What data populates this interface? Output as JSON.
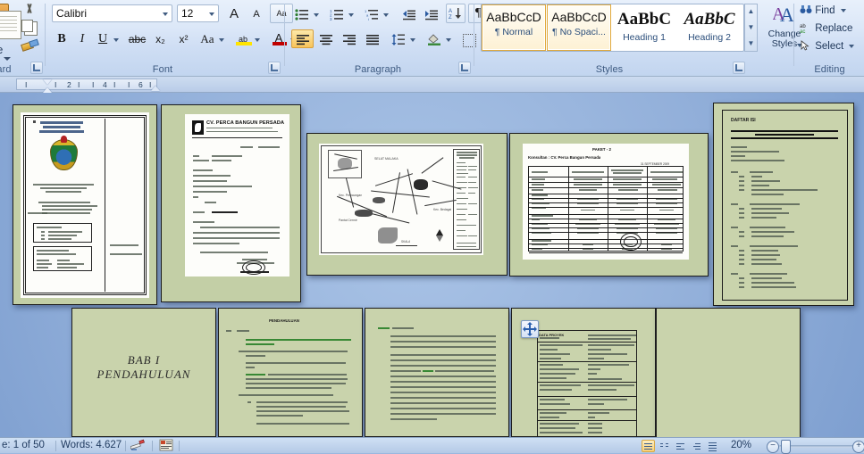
{
  "ribbon": {
    "groups": [
      {
        "name": "Clipboard",
        "label": "board"
      },
      {
        "name": "Font",
        "label": "Font"
      },
      {
        "name": "Paragraph",
        "label": "Paragraph"
      },
      {
        "name": "Styles",
        "label": "Styles"
      },
      {
        "name": "Editing",
        "label": "Editing"
      }
    ],
    "clipboard": {
      "paste_label": "ste",
      "group_label": "board"
    },
    "font": {
      "font_name": "Calibri",
      "font_size": "12",
      "bold": "B",
      "italic": "I",
      "underline": "U",
      "strikethrough": "abc",
      "subscript": "x₂",
      "superscript": "x²",
      "change_case": "Aa",
      "highlight": "ab",
      "font_color": "A",
      "grow_font": "A",
      "shrink_font": "A",
      "clear_formatting": "Aa",
      "group_label": "Font"
    },
    "paragraph": {
      "group_label": "Paragraph"
    },
    "styles": {
      "group_label": "Styles",
      "items": [
        {
          "sample": "AaBbCcD",
          "name": "¶ Normal",
          "selected": true
        },
        {
          "sample": "AaBbCcD",
          "name": "¶ No Spaci...",
          "selected": true
        },
        {
          "sample": "AaBbC",
          "name": "Heading 1",
          "selected": false
        },
        {
          "sample": "AaBbC",
          "name": "Heading 2",
          "selected": false
        }
      ],
      "change_styles_line1": "Change",
      "change_styles_line2": "Styles"
    },
    "editing": {
      "group_label": "Editing",
      "find": "Find",
      "replace": "Replace",
      "select": "Select"
    }
  },
  "ruler": {
    "ticks": [
      "I",
      "I",
      "2",
      "I",
      "I",
      "4",
      "I",
      "I",
      "6",
      "I"
    ]
  },
  "workspace": {
    "thumbnails": [
      {
        "id": "cover-page",
        "kind": "cover",
        "title_lines": [
          "PEMERINTAH PROPINSI",
          "SUMATERA UTARA",
          "DINAS BINA MARGA"
        ],
        "subtitle_lines": [
          "PEKERJAAN PENGAWASAN TEKNIS JALAN DAN",
          "PEMELIHARAAN RUTIN JALAN",
          "DAERAH KABUPATEN DAIRI"
        ],
        "list_lines": [
          "JENIS PEKERJAAN : PENGAWASAN TEKNIS",
          "1.  JALAN PERBAUNGAN - P. CERMIN",
          "2.  JALAN TJ. MORAWA - SEI RAMPAH",
          "3.  JALAN PERBAUNGAN - PANTAI CERMIN"
        ],
        "box1_lines": [
          "TAHUN ANGGARAN 2009",
          "1.    PENGAWASAN TEKNIS JALAN",
          "2.    PEMELIHARAAN RUTIN",
          "3.    PEMBANGUNAN"
        ],
        "box2_lines": [
          "KONSULTAN PENGAWAS :",
          "CV. PERCA BANGUN PERSADA",
          "Jl. Sei Mencirim No. 88",
          "Medan - Sumatera Utara",
          "Telp. : 061-8456789"
        ],
        "side_lines": [
          "LAPORAN BULANAN",
          "PERIODE : DESEMBER 2009"
        ]
      },
      {
        "id": "letter-page",
        "kind": "letter",
        "company": "CV. PERCA BANGUN PERSADA",
        "company_sub1": "CONSULTING ENGINEERS  •  PLANNING  •  SUPERVISION  •  MANAGEMENT",
        "company_sub2": "Jl. Sei Mencirim No. 88 Medan  Telp. (061) 845-6789  Fax (061) 845-6790",
        "date_place": "Medan,",
        "date_value": "September 2009",
        "ref_label": "No.",
        "ref_value": ": 45/CV-PBP/IX/2009",
        "att_label": "Lampiran",
        "att_value": ": 1 (satu) berkas",
        "to_lines": [
          "Kepada Yth :",
          "Bapak Pengguna Anggaran",
          "Bidang Pembinaan Teknis",
          "Dinas Bina Marga Propinsi Sumatera Utara",
          "Jalan Sakti Lubis No. 7B",
          "di -",
          "        Medan"
        ],
        "subject_label": "Perihal",
        "subject_value": ":  Laporan Bulanan",
        "salutation": "Dengan hormat,",
        "body_lines": [
          "Berdasarkan Surat Perjanjian Kerja / Kontrak Konsultan Paket 2 (dua), Pekerjaan",
          "Pengawasan Teknis dan Nomor : 602 / 086 / BT / KTR / 179 / 2009 tertanggal",
          "4  Agustus  2009, bersama ini kami sampaikan  Laporan Bulanan  untuk bulan September",
          "2009 sebagaimana terlampir.",
          "Demikian kami sampaikan, atas perhatian Bapak kami ucapkan terima kasih."
        ],
        "sign_lines": [
          "Konsultan Pengawas",
          "CV. PERCA BANGUN PERSADA"
        ],
        "sign_name": "MUHAMMAD SUWANDI",
        "sign_title": "Direktur Utama"
      },
      {
        "id": "map-page",
        "kind": "map",
        "legend_title_lines": [
          "PETA ADMINISTRASI KABUPATEN",
          "KABUPATEN SERDANG BEDAGAI",
          "PETA PENGAWASAN"
        ],
        "map_label1": "SELAT MALAKA",
        "map_label2": "Kec. Perbaungan",
        "map_label3": "Kec. Pantai Cermin",
        "scale_label": "SKALA"
      },
      {
        "id": "table-page",
        "kind": "table",
        "title": "PAKET - 2",
        "subtitle": "Konsultan : CV. Perca Bangun Persada",
        "date_note": "31 SEPTEMBER 2009",
        "columns": [
          "Nama Paket",
          "Jalan PERBAUNGAN - P. CERMIN",
          "JALAN SIMPANG KANAN - SEI RAMPAH - PERBAUNGAN",
          "Jalan PERBAUNGAN - BEDAGAI"
        ],
        "rows": [
          [
            "KONTRAKTOR",
            "PT. SARANA BUMI SEJATI",
            "PT. KARYA BUMI PERKASA",
            "PT. ARTA NIRMALA"
          ],
          [
            "No. Kontrak",
            "600 / 345 / APBD / 2009",
            "600 / 346 / APBD / 2009",
            "600 / 348 / APBD / 2009"
          ],
          [
            "Tgl. Kontrak",
            "14 JULI 2009",
            "3 AGUSTUS 2009",
            "3 AGUSTUS 2009"
          ],
          [
            "DANA PROYEK",
            "",
            "",
            ""
          ],
          [
            "Nilai Kontrak",
            "Rp 1.983.510.000",
            "Rp 1.983.510.000",
            "Rp 1.983.510.000"
          ],
          [
            "Nilai Kontrak Sekarang",
            "Rp 1.648.900.000",
            "Rp 1.748.214.000",
            "Rp 1.548.830.000"
          ],
          [
            "Panjang Efektif",
            "1,200 KM",
            "2,900 KM",
            "1,100 KM"
          ],
          [
            "MASA PELAKSANAAN",
            "",
            "",
            ""
          ],
          [
            "Mulai",
            "14 JULI 2009",
            "7 AGUSTUS 2009",
            "7 AGUSTUS 2009"
          ],
          [
            "Perkiraan Selesai",
            "28 NOPEMBER 2009",
            "28 NOPEMBER 2009",
            "28 NOPEMBER 2009"
          ],
          [
            "Waktu Pelaksanaan",
            "90 Hari Kalender",
            "120 Hari Kalender",
            "120 Hari Kalender"
          ],
          [
            "Masa Pemeliharaan",
            "180 Hari Kalender",
            "180 Hari Kalender",
            "180 Hari Kalender"
          ],
          [
            "BOBOT / TERPASANG",
            "",
            "",
            ""
          ],
          [
            "Rencana s/d Sekarang",
            "55,70 %",
            "32,40 %",
            "35,70 %"
          ],
          [
            "Realisasi",
            "56,13 %",
            "33,15 %",
            "36,20 %"
          ],
          [
            "PROGRESS",
            "",
            "",
            ""
          ],
          [
            "Rencana",
            "45,70",
            "31,80",
            "35,90"
          ],
          [
            "Realisasi",
            "46,13",
            "32,40",
            "36,20"
          ],
          [
            "Deviasi",
            "+0,43",
            "+0,60",
            "+0,30"
          ]
        ]
      },
      {
        "id": "toc-page",
        "kind": "toc",
        "title": "DAFTAR ISI",
        "banner": "LAPORAN BULANAN SEPTEMBER 2009",
        "header_lines": [
          "KEGIATAN :",
          "PENGAWASAN TEKNIS JALAN DAN JEMBATAN",
          "PAKET : 2",
          "PEKERJAAN : PENGAWASAN TEKNIS JALAN"
        ],
        "entries": [
          {
            "num": "BAB   I",
            "title": "PENDAHULUAN"
          },
          {
            "num": "1.1",
            "title": "UMUM"
          },
          {
            "num": "1.2",
            "title": "LATAR BELAKANG PROYEK"
          },
          {
            "num": "1.3",
            "title": "DATA PROYEK"
          },
          {
            "num": "1.4",
            "title": "MAKSUD DAN TUJUAN PEKERJAAN PENGAWASAN"
          },
          {
            "num": "BAB   II",
            "title": "ORGANISASI PELAKSANA PEKERJAAN"
          },
          {
            "num": "2.1",
            "title": "PEMBERI PEKERJAAN"
          },
          {
            "num": "2.2",
            "title": "PELAKSANA KEGIATAN PROYEK"
          },
          {
            "num": "2.3",
            "title": "PIHAK KONSULTAN"
          },
          {
            "num": "BAB   III",
            "title": "PELAKSANAAN PEKERJAAN"
          },
          {
            "num": "3.1",
            "title": "PELAKSANAAN PENGAWASAN"
          },
          {
            "num": "3.2",
            "title": "PENGENDALIAN MUTU"
          },
          {
            "num": "BAB   IV",
            "title": "KEMAJUAN PELAKSANAAN PROYEK"
          },
          {
            "num": "4.1",
            "title": "RENCANA PEKERJAAN"
          },
          {
            "num": "4.2",
            "title": "RENCANA PELAKSANAAN"
          },
          {
            "num": "4.3",
            "title": "RENCANA KEMAJUAN"
          },
          {
            "num": "4.4",
            "title": "RENCANA PROGRES KERJA"
          },
          {
            "num": "BAB   V",
            "title": "KESIMPULAN DAN SARAN"
          },
          {
            "num": "5.1",
            "title": "UMUM DAN KESIMPULAN"
          },
          {
            "num": "5.2",
            "title": "LAPORAN PENGAWASAN LAPANGAN"
          },
          {
            "num": "5.3",
            "title": "EVALUASI PEKERJAAN LAPANGAN"
          },
          {
            "num": "LAMPIRAN",
            "title": "FOTO DOKUMENTASI"
          }
        ]
      },
      {
        "id": "bab1-page",
        "kind": "chapter",
        "line1": "BAB I",
        "line2": "PENDAHULUAN"
      },
      {
        "id": "intro-page",
        "kind": "body-green",
        "heading": "PENDAHULUAN",
        "section_num": "1.1",
        "section_title": "UMUM",
        "paragraphs": [
          "Pembangunan prasarana jalan merupakan salah satu sarana penunjang",
          "pertumbuhan ekonomi daerah, sehingga perlu dilakukan peningkatan dan",
          "pemeliharaan jalan secara terus menerus agar dapat berfungsi dengan baik.",
          "Dalam rangka peningkatan pelayanan transportasi, Pemerintah Propinsi",
          "Sumatera Utara melalui Dinas Bina Marga melaksanakan kegiatan",
          "pengawasan teknis jalan dan jembatan pada ruas-ruas jalan propinsi.",
          "Untuk mencapai hasil pekerjaan yang optimal diperlukan pengawasan",
          "yang ketat dan berkesinambungan selama masa pelaksanaan pekerjaan",
          "berlangsung sesuai dengan spesifikasi teknis yang telah ditentukan."
        ]
      },
      {
        "id": "body-page",
        "kind": "body",
        "section_num": "1.2",
        "section_title": "LATAR BELAKANG",
        "paragraphs": [
          "Dinas Bina Marga Propinsi Sumatera Utara sebagai instansi pemerintah",
          "yang bertanggung jawab terhadap pembinaan jalan propinsi setiap",
          "tahunnya melaksanakan program peningkatan dan pemeliharaan jalan",
          "yang menghubungkan kabupaten/kota dalam wilayah Propinsi Sumatera",
          "Utara. Program tersebut dibiayai melalui dana APBD Propinsi Sumatera",
          "Utara Tahun Anggaran 2009. Dalam pelaksanaannya Dinas Bina Marga",
          "menggunakan jasa konsultan pengawas untuk melakukan pengawasan",
          "teknis terhadap pekerjaan yang dilaksanakan oleh kontraktor pelaksana",
          "sehingga mutu pekerjaan dapat dipertanggungjawabkan sesuai dengan",
          "ketentuan dan persyaratan teknis yang berlaku serta tepat waktu dan",
          "tepat mutu sesuai kontrak."
        ]
      },
      {
        "id": "data-table-page",
        "kind": "data-table",
        "title": "DATA PROYEK",
        "rows": [
          [
            "Nama Kegiatan",
            "Pengawasan Teknis Jalan dan Jembatan"
          ],
          [
            "Nama Pekerjaan",
            "Pengawasan Teknis Jalan Paket 2 (dua)"
          ],
          [
            "Lokasi Pekerjaan",
            "Kabupaten Serdang Bedagai"
          ],
          [
            "Sumber Dana",
            "APBD Propinsi Sumatera Utara T.A. 2009"
          ],
          [
            "Nomor Kontrak",
            "602 / 086 / BT / KTR / 179 / 2009"
          ],
          [
            "Tanggal Kontrak",
            "4 Agustus 2009"
          ],
          [
            "Nilai Kontrak",
            "Rp. 148.500.000,-"
          ],
          [
            "Waktu Pelaksanaan",
            "120 Hari Kalender"
          ],
          [
            "Konsultan Pengawas",
            "CV. Perca Bangun Persada"
          ],
          [
            "Kontraktor Pelaksana",
            "PT. Sarana Bumi Sejati"
          ]
        ],
        "cursor": "move-cursor"
      },
      {
        "id": "blank-page",
        "kind": "blank"
      }
    ]
  },
  "status_bar": {
    "page_info": "e: 1 of 50",
    "word_count": "Words: 4.627",
    "proofing_icon": "proofing-errors-icon",
    "language_icon": "language-icon",
    "view_buttons": [
      "print-layout",
      "full-screen-reading",
      "web-layout",
      "outline",
      "draft"
    ],
    "zoom_level": "20%",
    "zoom_out": "−",
    "zoom_in": "+"
  }
}
